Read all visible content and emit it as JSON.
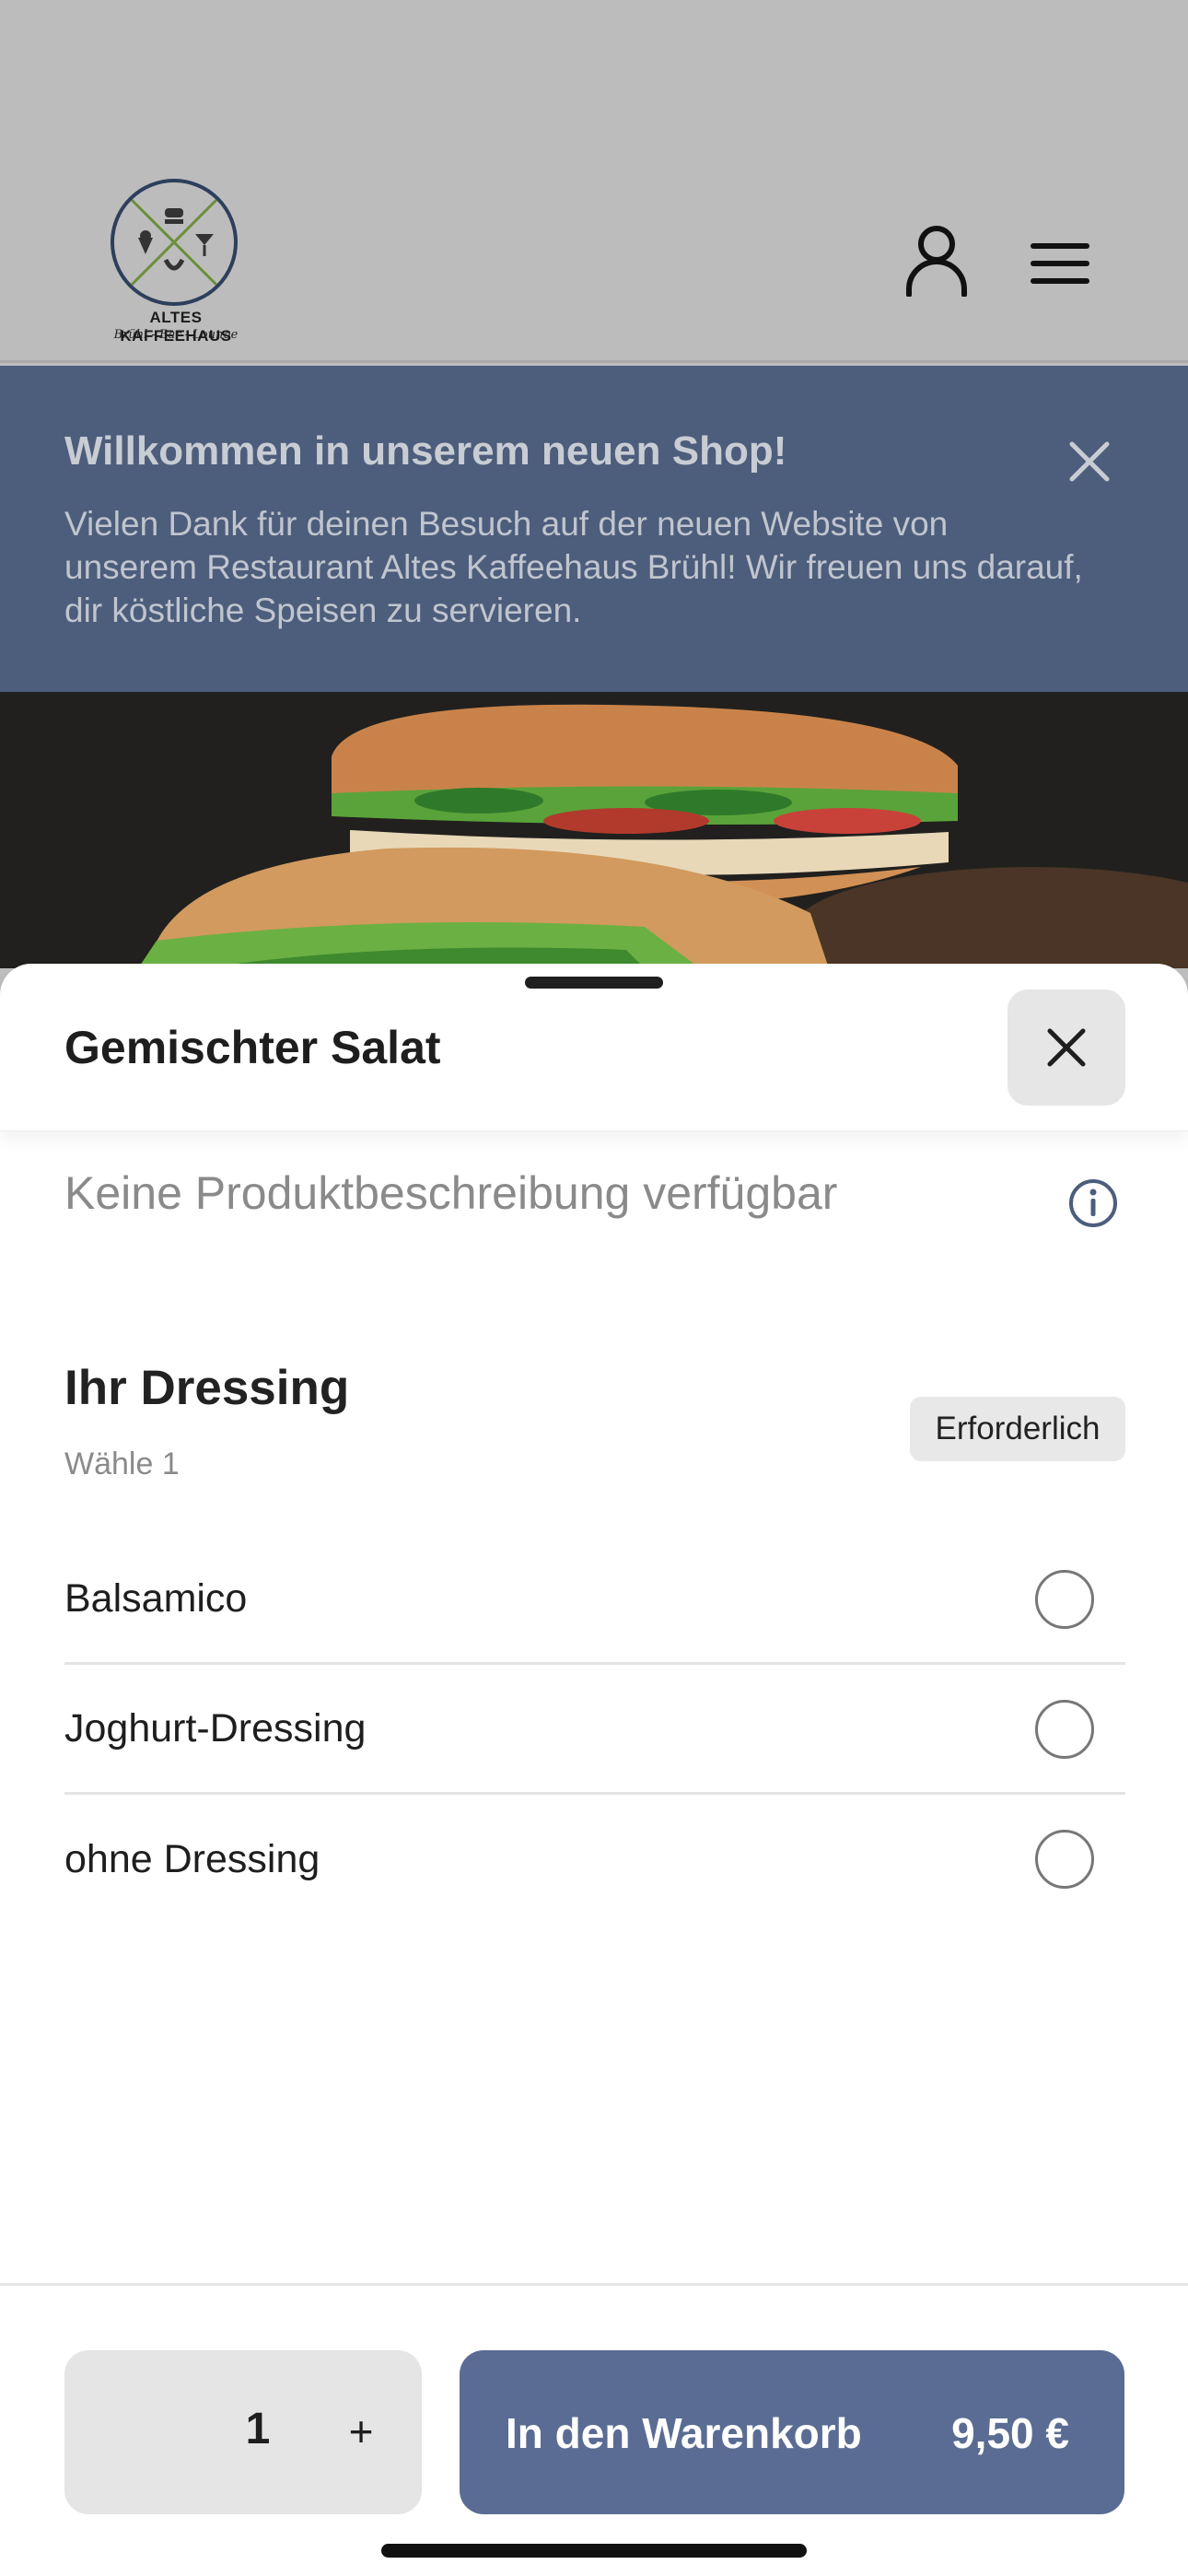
{
  "header": {
    "logo_name": "ALTES KAFFEEHAUS",
    "logo_subtitle": "Brühl - Bar - Lounge",
    "user_icon": "user-icon",
    "menu_icon": "hamburger-menu-icon"
  },
  "banner": {
    "title": "Willkommen in unserem neuen Shop!",
    "text": "Vielen Dank für deinen Besuch auf der neuen Website von unserem Restaurant Altes Kaffeehaus Brühl! Wir freuen uns darauf, dir köstliche Speisen zu servieren.",
    "close_icon": "close-icon"
  },
  "hero": {
    "image": "sandwich-photo"
  },
  "product": {
    "title": "Gemischter Salat",
    "description": "Keine Produktbeschreibung verfügbar",
    "close_icon": "close-icon",
    "info_icon": "info-icon"
  },
  "option_group": {
    "title": "Ihr Dressing",
    "subtitle": "Wähle 1",
    "badge": "Erforderlich",
    "options": [
      {
        "label": "Balsamico",
        "selected": false
      },
      {
        "label": "Joghurt-Dressing",
        "selected": false
      },
      {
        "label": "ohne Dressing",
        "selected": false
      }
    ]
  },
  "footer": {
    "quantity": "1",
    "plus_label": "+",
    "cart_label": "In den Warenkorb",
    "price": "9,50 €"
  },
  "colors": {
    "banner_bg": "#4d5d7c",
    "primary_button": "#5a6c93",
    "dim_overlay": "#bdbdbd"
  }
}
